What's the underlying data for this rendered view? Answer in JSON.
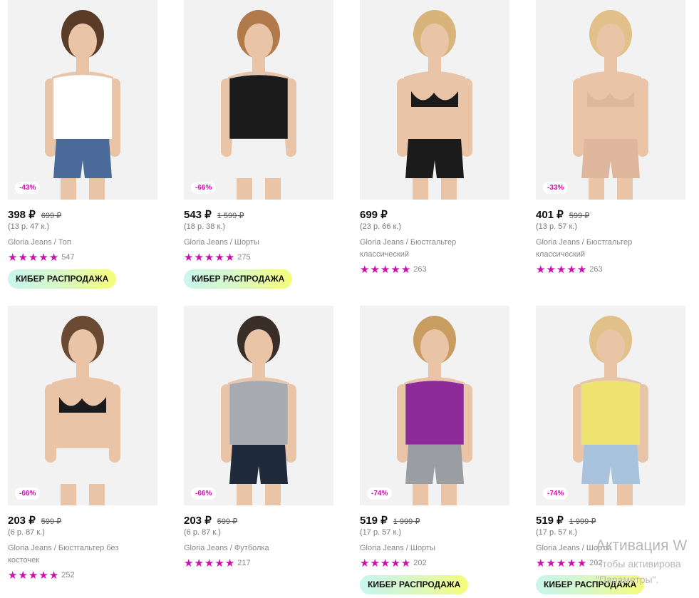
{
  "colors": {
    "accent": "#cb11ab",
    "star": "#cb11ab",
    "promo_gradient": [
      "#c9f6ee",
      "#f6fc7a"
    ]
  },
  "products": [
    {
      "discount": "-43%",
      "price": "398 ₽",
      "old_price": "699 ₽",
      "split": "(13 р. 47 к.)",
      "name": "Gloria Jeans / Топ",
      "rating": 5,
      "reviews": "547",
      "promo": "КИБЕР РАСПРОДАЖА"
    },
    {
      "discount": "-66%",
      "price": "543 ₽",
      "old_price": "1 599 ₽",
      "split": "(18 р. 38 к.)",
      "name": "Gloria Jeans / Шорты",
      "rating": 5,
      "reviews": "275",
      "promo": "КИБЕР РАСПРОДАЖА"
    },
    {
      "discount": "",
      "price": "699 ₽",
      "old_price": "",
      "split": "(23 р. 66 к.)",
      "name": "Gloria Jeans / Бюстгальтер классический",
      "rating": 5,
      "reviews": "263",
      "promo": ""
    },
    {
      "discount": "-33%",
      "price": "401 ₽",
      "old_price": "599 ₽",
      "split": "(13 р. 57 к.)",
      "name": "Gloria Jeans / Бюстгальтер классический",
      "rating": 5,
      "reviews": "263",
      "promo": ""
    },
    {
      "discount": "-66%",
      "price": "203 ₽",
      "old_price": "599 ₽",
      "split": "(6 р. 87 к.)",
      "name": "Gloria Jeans / Бюстгальтер без косточек",
      "rating": 5,
      "reviews": "252",
      "promo": ""
    },
    {
      "discount": "-66%",
      "price": "203 ₽",
      "old_price": "599 ₽",
      "split": "(6 р. 87 к.)",
      "name": "Gloria Jeans / Футболка",
      "rating": 5,
      "reviews": "217",
      "promo": ""
    },
    {
      "discount": "-74%",
      "price": "519 ₽",
      "old_price": "1 999 ₽",
      "split": "(17 р. 57 к.)",
      "name": "Gloria Jeans / Шорты",
      "rating": 5,
      "reviews": "202",
      "promo": "КИБЕР РАСПРОДАЖА"
    },
    {
      "discount": "-74%",
      "price": "519 ₽",
      "old_price": "1 999 ₽",
      "split": "(17 р. 57 к.)",
      "name": "Gloria Jeans / Шорты",
      "rating": 5,
      "reviews": "202",
      "promo": "КИБЕР РАСПРОДАЖА"
    }
  ],
  "watermark": {
    "title": "Активация W",
    "line1": "Чтобы активирова",
    "line2": "\"Параметры\"."
  }
}
